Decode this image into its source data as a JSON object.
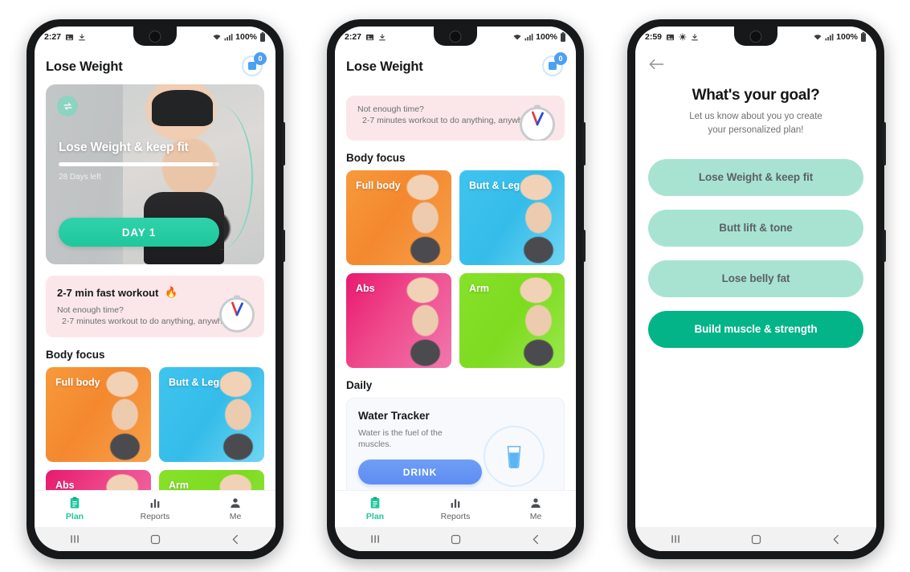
{
  "colors": {
    "accent_teal": "#1fc79c",
    "selected_green": "#02b487",
    "idle_green": "#a8e3d2",
    "blue_button": "#5d8df2",
    "pink_card": "#fbe7e9"
  },
  "phone1": {
    "status": {
      "time": "2:27",
      "battery": "100%",
      "icons": [
        "image-icon",
        "download-icon",
        "wifi-icon",
        "signal-icon",
        "battery-icon"
      ]
    },
    "header": {
      "title": "Lose Weight",
      "badge_count": "0"
    },
    "hero": {
      "title": "Lose Weight & keep fit",
      "days_left": "28 Days left",
      "progress_percent": 96,
      "cta": "DAY 1"
    },
    "fast_workout": {
      "title": "2-7 min fast workout",
      "emoji": "🔥",
      "line1": "Not enough time?",
      "line2": "2-7 minutes workout to do anything, anywhere."
    },
    "body_focus": {
      "section_title": "Body focus",
      "tiles": [
        {
          "label": "Full body",
          "theme": "t-full"
        },
        {
          "label": "Butt & Leg",
          "theme": "t-butt"
        },
        {
          "label": "Abs",
          "theme": "t-abs"
        },
        {
          "label": "Arm",
          "theme": "t-arm"
        }
      ]
    },
    "nav": [
      {
        "label": "Plan",
        "icon": "clipboard-icon",
        "active": true
      },
      {
        "label": "Reports",
        "icon": "bar-chart-icon",
        "active": false
      },
      {
        "label": "Me",
        "icon": "person-icon",
        "active": false
      }
    ]
  },
  "phone2": {
    "status": {
      "time": "2:27",
      "battery": "100%"
    },
    "header": {
      "title": "Lose Weight",
      "badge_count": "0"
    },
    "fast_workout": {
      "line1": "Not enough time?",
      "line2": "2-7 minutes workout to do anything, anywhere."
    },
    "body_focus": {
      "section_title": "Body focus",
      "tiles": [
        {
          "label": "Full body",
          "theme": "t-full"
        },
        {
          "label": "Butt & Leg",
          "theme": "t-butt"
        },
        {
          "label": "Abs",
          "theme": "t-abs"
        },
        {
          "label": "Arm",
          "theme": "t-arm"
        }
      ]
    },
    "daily": {
      "section_title": "Daily",
      "water": {
        "title": "Water Tracker",
        "subtitle": "Water is the fuel of the muscles.",
        "button": "DRINK",
        "icon": "water-glass-icon"
      }
    },
    "nav": [
      {
        "label": "Plan",
        "icon": "clipboard-icon",
        "active": true
      },
      {
        "label": "Reports",
        "icon": "bar-chart-icon",
        "active": false
      },
      {
        "label": "Me",
        "icon": "person-icon",
        "active": false
      }
    ]
  },
  "phone3": {
    "status": {
      "time": "2:59",
      "battery": "100%"
    },
    "back_icon": "back-arrow-icon",
    "heading": "What's your goal?",
    "subheading_line1": "Let us know about you yo create",
    "subheading_line2": "your personalized plan!",
    "goals": [
      {
        "label": "Lose Weight & keep fit",
        "selected": false
      },
      {
        "label": "Butt lift & tone",
        "selected": false
      },
      {
        "label": "Lose belly fat",
        "selected": false
      },
      {
        "label": "Build muscle & strength",
        "selected": true
      }
    ]
  },
  "system_nav": {
    "recents": "recents-icon",
    "home": "home-icon",
    "back": "back-icon"
  }
}
